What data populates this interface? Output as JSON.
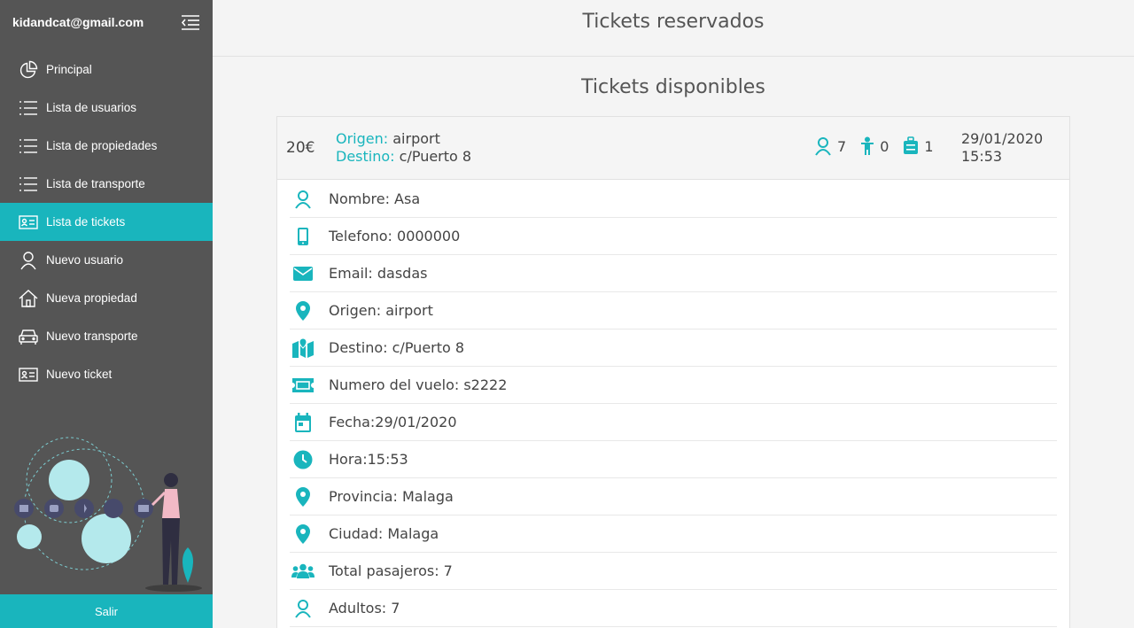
{
  "sidebar": {
    "email": "kidandcat@gmail.com",
    "items": [
      {
        "label": "Principal",
        "icon": "pie-chart-icon",
        "active": false
      },
      {
        "label": "Lista de usuarios",
        "icon": "list-icon",
        "active": false
      },
      {
        "label": "Lista de propiedades",
        "icon": "list-icon",
        "active": false
      },
      {
        "label": "Lista de transporte",
        "icon": "list-icon",
        "active": false
      },
      {
        "label": "Lista de tickets",
        "icon": "id-card-icon",
        "active": true
      },
      {
        "label": "Nuevo usuario",
        "icon": "user-icon",
        "active": false
      },
      {
        "label": "Nueva propiedad",
        "icon": "home-icon",
        "active": false
      },
      {
        "label": "Nuevo transporte",
        "icon": "car-icon",
        "active": false
      },
      {
        "label": "Nuevo ticket",
        "icon": "id-card-icon",
        "active": false
      }
    ],
    "logout_label": "Salir"
  },
  "main": {
    "reserved_title": "Tickets reservados",
    "available_title": "Tickets disponibles",
    "ticket": {
      "price": "20€",
      "origin_key": "Origen:",
      "origin_value": "airport",
      "destination_key": "Destino:",
      "destination_value": "c/Puerto 8",
      "adults_count": "7",
      "children_count": "0",
      "luggage_count": "1",
      "date": "29/01/2020",
      "time": "15:53",
      "details": [
        {
          "icon": "user-icon",
          "text": "Nombre: Asa"
        },
        {
          "icon": "phone-icon",
          "text": "Telefono: 0000000"
        },
        {
          "icon": "envelope-icon",
          "text": "Email: dasdas"
        },
        {
          "icon": "map-marker-icon",
          "text": "Origen: airport"
        },
        {
          "icon": "map-icon",
          "text": "Destino: c/Puerto 8"
        },
        {
          "icon": "ticket-icon",
          "text": "Numero del vuelo: s2222"
        },
        {
          "icon": "calendar-icon",
          "text": "Fecha:29/01/2020"
        },
        {
          "icon": "clock-icon",
          "text": "Hora:15:53"
        },
        {
          "icon": "map-marker-icon",
          "text": "Provincia: Malaga"
        },
        {
          "icon": "map-marker-icon",
          "text": "Ciudad: Malaga"
        },
        {
          "icon": "users-icon",
          "text": "Total pasajeros: 7"
        },
        {
          "icon": "user-icon",
          "text": "Adultos: 7"
        }
      ]
    }
  },
  "colors": {
    "accent": "#19b5bd",
    "sidebar_bg": "#555555",
    "page_bg": "#f4f4f4"
  }
}
